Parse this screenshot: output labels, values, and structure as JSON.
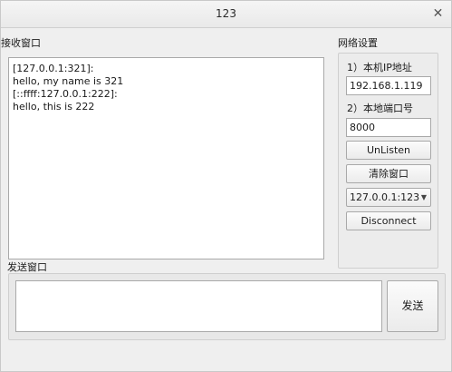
{
  "window": {
    "title": "123",
    "close_glyph": "✕"
  },
  "receive": {
    "label": "接收窗口",
    "lines": [
      "[127.0.0.1:321]:",
      "hello, my name is 321",
      "[::ffff:127.0.0.1:222]:",
      "hello, this is 222"
    ]
  },
  "network": {
    "label": "网络设置",
    "local_ip_label": "1）本机IP地址",
    "local_ip_value": "192.168.1.119",
    "local_port_label": "2）本地端口号",
    "local_port_value": "8000",
    "unlisten_label": "UnListen",
    "clear_label": "清除窗口",
    "client_select_value": "127.0.0.1:123",
    "select_arrow_glyph": "▼",
    "disconnect_label": "Disconnect"
  },
  "send": {
    "label": "发送窗口",
    "input_value": "",
    "button_label": "发送"
  }
}
